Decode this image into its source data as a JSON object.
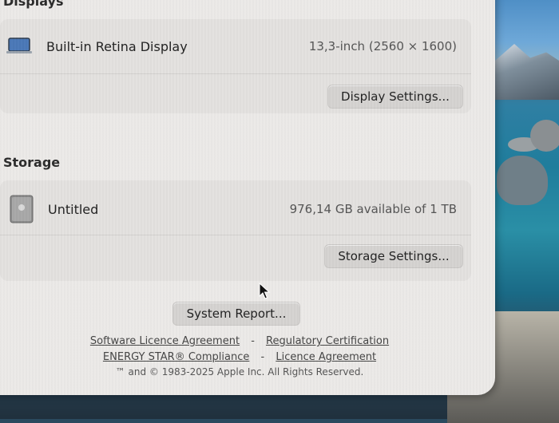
{
  "displays": {
    "heading": "Displays",
    "item": {
      "name": "Built-in Retina Display",
      "spec": "13,3-inch (2560 × 1600)",
      "icon": "laptop-icon"
    },
    "settings_button": "Display Settings..."
  },
  "storage": {
    "heading": "Storage",
    "item": {
      "name": "Untitled",
      "capacity": "976,14 GB available of 1 TB",
      "icon": "disk-icon"
    },
    "settings_button": "Storage Settings..."
  },
  "system_report_button": "System Report...",
  "footer": {
    "links_row1": [
      "Software Licence Agreement",
      "Regulatory Certification"
    ],
    "links_row2": [
      "ENERGY STAR® Compliance",
      "Licence Agreement"
    ],
    "separator": "-",
    "copyright": "™ and © 1983-2025 Apple Inc. All Rights Reserved."
  }
}
